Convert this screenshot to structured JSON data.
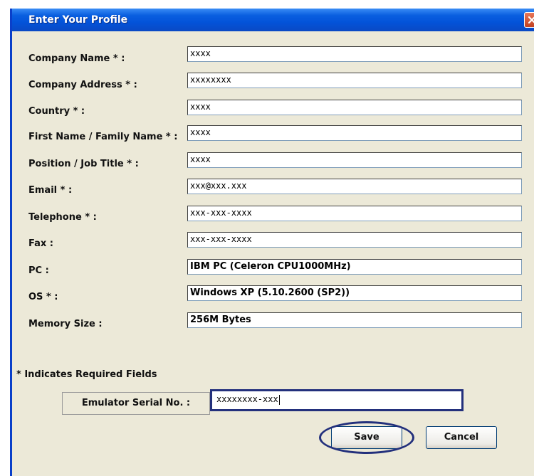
{
  "window": {
    "title": "Enter Your Profile"
  },
  "form": {
    "fields": [
      {
        "label": "Company Name * :",
        "value": "xxxx"
      },
      {
        "label": "Company Address * :",
        "value": "xxxxxxxx"
      },
      {
        "label": "Country * :",
        "value": "xxxx"
      },
      {
        "label": "First Name / Family Name * :",
        "value": "xxxx"
      },
      {
        "label": "Position / Job Title * :",
        "value": "xxxx"
      },
      {
        "label": "Email * :",
        "value": "xxx@xxx.xxx"
      },
      {
        "label": "Telephone * :",
        "value": "xxx-xxx-xxxx"
      },
      {
        "label": "Fax :",
        "value": "xxx-xxx-xxxx"
      },
      {
        "label": "PC :",
        "value": "IBM PC (Celeron CPU1000MHz)"
      },
      {
        "label": "OS * :",
        "value": "Windows XP (5.10.2600 (SP2))"
      },
      {
        "label": "Memory Size :",
        "value": "256M Bytes"
      }
    ],
    "required_note": "* Indicates Required Fields",
    "serial_label": "Emulator Serial No. :",
    "serial_value": "xxxxxxxx-xxx"
  },
  "buttons": {
    "save": "Save",
    "cancel": "Cancel"
  },
  "colors": {
    "titlebar": "#0a5fe0",
    "dialog_bg": "#ece9d8",
    "highlight": "#23307c",
    "close_button": "#c2401f"
  },
  "icons": {
    "close": "close-icon"
  }
}
